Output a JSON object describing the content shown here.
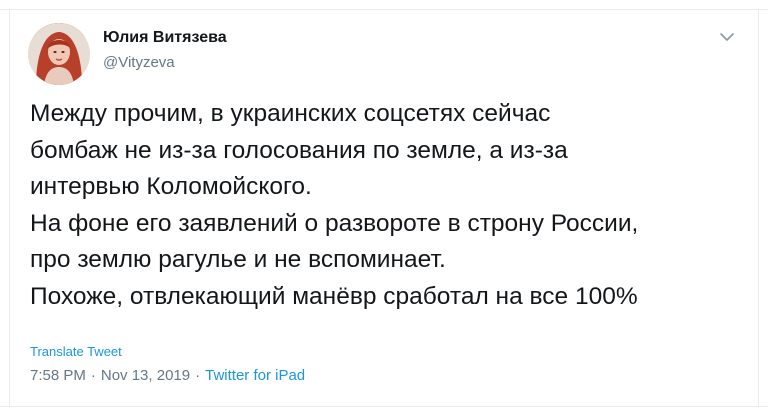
{
  "author": {
    "display_name": "Юлия Витязева",
    "handle": "@Vityzeva",
    "avatar_icon": "profile-photo"
  },
  "tweet": {
    "lines": [
      "Между прочим, в украинских соцсетях сейчас",
      "бомбаж не из-за голосования по земле, а из-за",
      "интервью Коломойского.",
      "На фоне его заявлений о развороте в строну России,",
      "про землю рагулье и не вспоминает.",
      "Похоже, отвлекающий манёвр сработал на все 100%"
    ]
  },
  "actions": {
    "translate_label": "Translate Tweet",
    "menu_icon": "chevron-down-icon"
  },
  "meta": {
    "time": "7:58 PM",
    "separator": "·",
    "date": "Nov 13, 2019",
    "source": "Twitter for iPad"
  },
  "colors": {
    "link": "#1b95e0",
    "secondary_text": "#657786",
    "primary_text": "#14171a",
    "border": "#e6ecf0"
  }
}
